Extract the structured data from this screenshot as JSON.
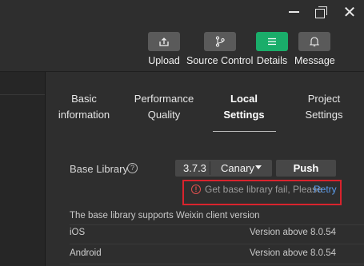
{
  "window_controls": {
    "minimize_icon": "minimize-icon",
    "restore_icon": "restore-icon",
    "close_icon": "close-icon",
    "close_glyph": "✕"
  },
  "toolbar": {
    "items": [
      {
        "label": "Upload",
        "icon": "upload-icon",
        "active": false
      },
      {
        "label": "Source Control",
        "icon": "branch-icon",
        "active": false
      },
      {
        "label": "Details",
        "icon": "menu-lines-icon",
        "active": true
      },
      {
        "label": "Message",
        "icon": "bell-icon",
        "active": false
      }
    ],
    "active_color": "#1aad6a"
  },
  "tabs": [
    {
      "label": "Basic\ninformation",
      "active": false
    },
    {
      "label": "Performance\nQuality",
      "active": false
    },
    {
      "label": "Local\nSettings",
      "active": true
    },
    {
      "label": "Project\nSettings",
      "active": false
    }
  ],
  "base_library": {
    "label": "Base Library",
    "help_glyph": "?",
    "version": "3.7.3",
    "channel": "Canary",
    "push_label": "Push"
  },
  "error": {
    "icon_glyph": "!",
    "message": "Get base library fail, Please",
    "retry": "Retry",
    "highlight_color": "#d9232d"
  },
  "support": {
    "heading": "The base library supports Weixin client version",
    "rows": [
      {
        "platform": "iOS",
        "value": "Version above 8.0.54"
      },
      {
        "platform": "Android",
        "value": "Version above 8.0.54"
      }
    ]
  }
}
